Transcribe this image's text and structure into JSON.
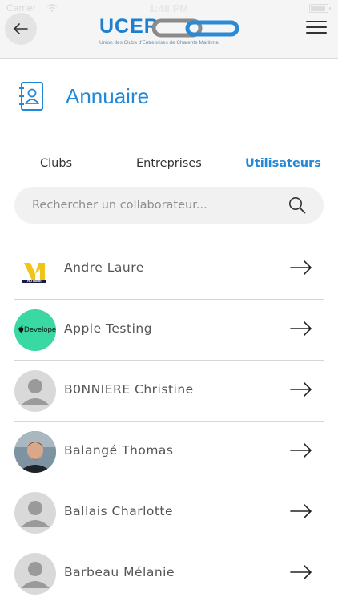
{
  "status_bar": {
    "carrier": "Carrier",
    "time": "1:48 PM"
  },
  "header": {
    "logo_title": "UCER",
    "logo_subtitle": "Union des Clubs d'Entreprises de Charente Maritime",
    "accent_color": "#1d7fd1"
  },
  "page": {
    "title": "Annuaire"
  },
  "tabs": [
    {
      "label": "Clubs",
      "active": false
    },
    {
      "label": "Entreprises",
      "active": false
    },
    {
      "label": "Utilisateurs",
      "active": true
    }
  ],
  "search": {
    "placeholder": "Rechercher un collaborateur...",
    "value": ""
  },
  "users": [
    {
      "name": "Andre Laure",
      "avatar": "notaire-logo",
      "avatar_label": "NOTAIRE"
    },
    {
      "name": "Apple Testing",
      "avatar": "apple-developer-logo",
      "avatar_label": "Developer"
    },
    {
      "name": "B0NNIERE Christine",
      "avatar": "person-placeholder-icon"
    },
    {
      "name": "Balangé Thomas",
      "avatar": "profile-photo"
    },
    {
      "name": "Ballais Charlotte",
      "avatar": "person-placeholder-icon"
    },
    {
      "name": "Barbeau Mélanie",
      "avatar": "person-placeholder-icon"
    }
  ]
}
